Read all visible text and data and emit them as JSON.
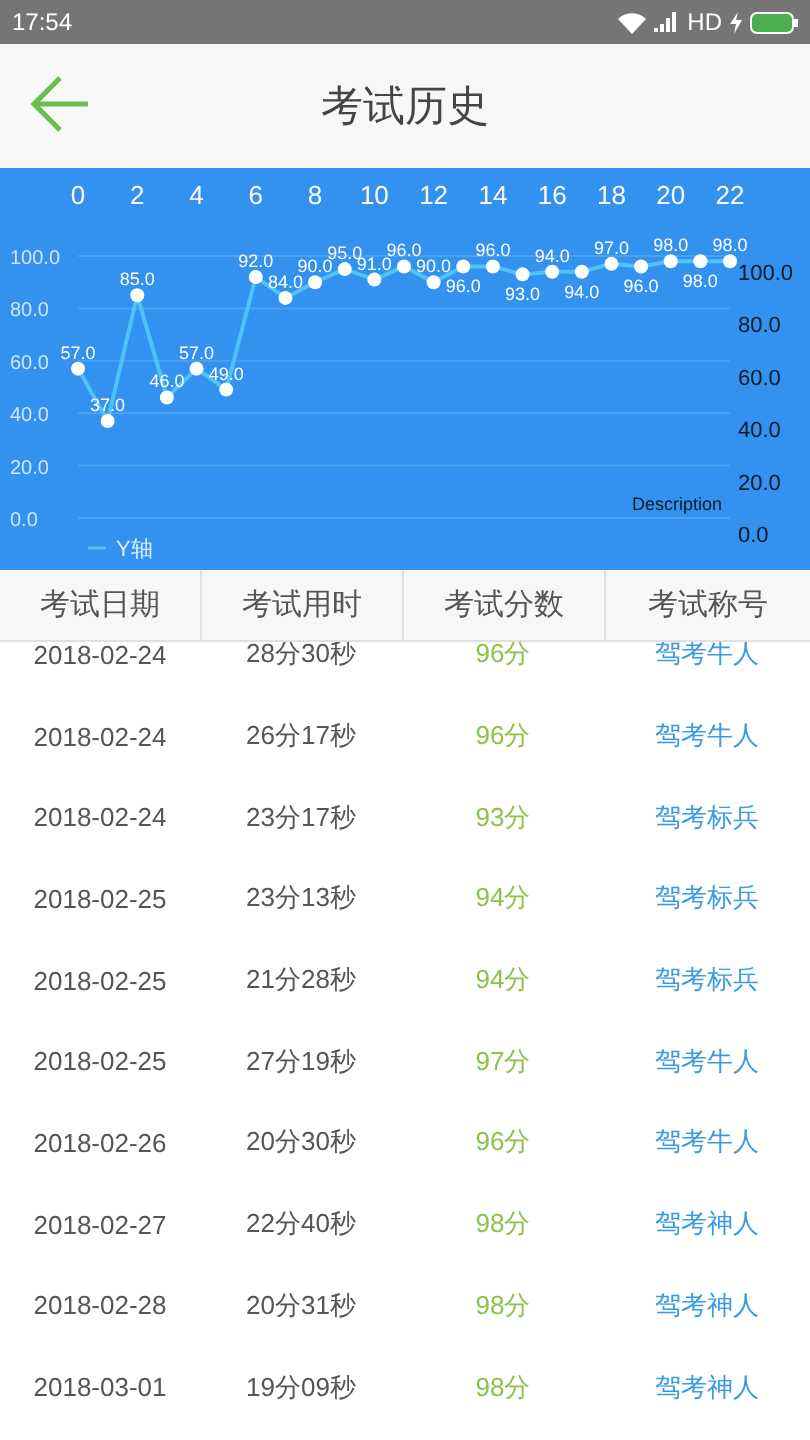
{
  "status_bar": {
    "time": "17:54",
    "network": "HD"
  },
  "header": {
    "title": "考试历史"
  },
  "chart": {
    "description": "Description",
    "chart_data": {
      "type": "line",
      "x": [
        0,
        1,
        2,
        3,
        4,
        5,
        6,
        7,
        8,
        9,
        10,
        11,
        12,
        13,
        14,
        15,
        16,
        17,
        18,
        19,
        20,
        21,
        22
      ],
      "series": [
        {
          "name": "Y轴",
          "color": "#4fc3f7",
          "marker": "circle",
          "values": [
            57,
            37,
            85,
            46,
            57,
            49,
            92,
            84,
            90,
            95,
            91,
            96,
            90,
            96,
            96,
            93,
            94,
            94,
            97,
            96,
            98,
            98,
            98
          ]
        }
      ],
      "value_labels": [
        "57.0",
        "37.0",
        "85.0",
        "46.0",
        "57.0",
        "49.0",
        "92.0",
        "84.0",
        "90.0",
        "95.0",
        "91.0",
        "96.0",
        "90.0",
        "96.0",
        "96.0",
        "93.0",
        "94.0",
        "94.0",
        "97.0",
        "96.0",
        "98.0",
        "98.0",
        "98.0"
      ],
      "grid": true,
      "xlim": [
        0,
        22
      ],
      "ylim": [
        0,
        100
      ],
      "xticks": [
        0,
        2,
        4,
        6,
        8,
        10,
        12,
        14,
        16,
        18,
        20,
        22
      ],
      "yticks": [
        {
          "value": 0,
          "label": "0.0"
        },
        {
          "value": 20,
          "label": "20.0"
        },
        {
          "value": 40,
          "label": "40.0"
        },
        {
          "value": 60,
          "label": "60.0"
        },
        {
          "value": 80,
          "label": "80.0"
        },
        {
          "value": 100,
          "label": "100.0"
        }
      ]
    }
  },
  "table": {
    "columns": [
      "考试日期",
      "考试用时",
      "考试分数",
      "考试称号"
    ],
    "rows": [
      [
        "2018-02-24",
        "28分30秒",
        "96分",
        "驾考牛人"
      ],
      [
        "2018-02-24",
        "26分17秒",
        "96分",
        "驾考牛人"
      ],
      [
        "2018-02-24",
        "23分17秒",
        "93分",
        "驾考标兵"
      ],
      [
        "2018-02-25",
        "23分13秒",
        "94分",
        "驾考标兵"
      ],
      [
        "2018-02-25",
        "21分28秒",
        "94分",
        "驾考标兵"
      ],
      [
        "2018-02-25",
        "27分19秒",
        "97分",
        "驾考牛人"
      ],
      [
        "2018-02-26",
        "20分30秒",
        "96分",
        "驾考牛人"
      ],
      [
        "2018-02-27",
        "22分40秒",
        "98分",
        "驾考神人"
      ],
      [
        "2018-02-28",
        "20分31秒",
        "98分",
        "驾考神人"
      ],
      [
        "2018-03-01",
        "19分09秒",
        "98分",
        "驾考神人"
      ]
    ]
  }
}
